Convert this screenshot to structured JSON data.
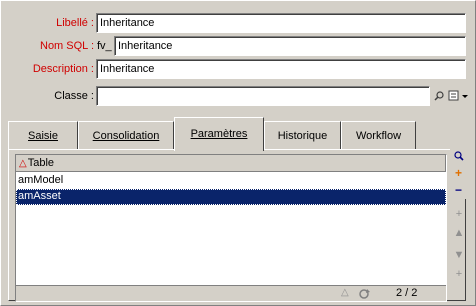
{
  "form": {
    "libelle_label": "Libellé :",
    "libelle_value": "Inheritance",
    "nomsql_label": "Nom SQL :",
    "nomsql_prefix": "fv_",
    "nomsql_value": "Inheritance",
    "description_label": "Description :",
    "description_value": "Inheritance",
    "classe_label": "Classe :",
    "classe_value": ""
  },
  "tabs": [
    {
      "label": "Saisie",
      "active": false
    },
    {
      "label": "Consolidation",
      "active": false
    },
    {
      "label": "Paramètres",
      "active": true
    },
    {
      "label": "Historique",
      "active": false
    },
    {
      "label": "Workflow",
      "active": false
    }
  ],
  "table": {
    "column_header": "Table",
    "rows": [
      {
        "value": "amModel",
        "selected": false
      },
      {
        "value": "amAsset",
        "selected": true
      }
    ],
    "pager": "2 / 2"
  },
  "colors": {
    "required_label": "#d00000",
    "selection": "#0a246a",
    "panel": "#d4d0c8"
  },
  "icons": [
    "search-icon",
    "list-icon",
    "dropdown-arrow-icon",
    "zoom-icon",
    "add-icon",
    "remove-icon",
    "move-up-icon",
    "move-down-icon",
    "refresh-icon",
    "sort-icon"
  ]
}
